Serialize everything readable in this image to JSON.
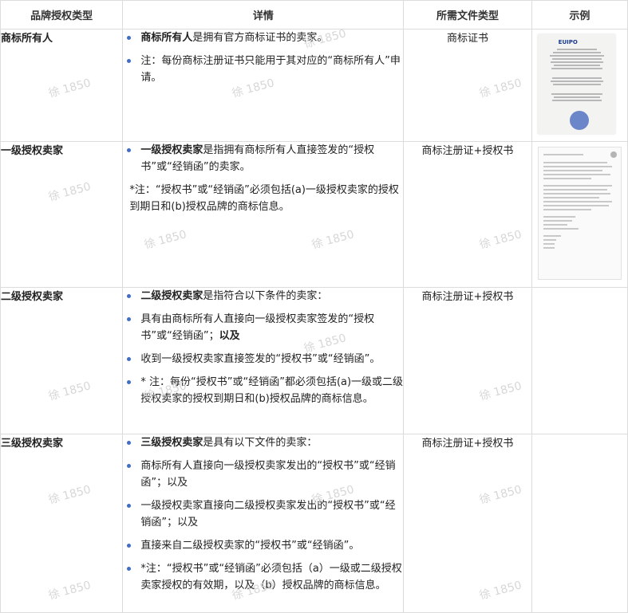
{
  "headers": [
    "品牌授权类型",
    "详情",
    "所需文件类型",
    "示例"
  ],
  "rows": [
    {
      "type": "商标所有人",
      "files": "商标证书",
      "bullets": [
        {
          "bold": "商标所有人",
          "text": "是拥有官方商标证书的卖家。"
        },
        {
          "bold": "",
          "text": "注：每份商标注册证书只能用于其对应的“商标所有人”申请。"
        }
      ],
      "note": "",
      "example": "certificate"
    },
    {
      "type": "一级授权卖家",
      "files": "商标注册证+授权书",
      "bullets": [
        {
          "bold": "一级授权卖家",
          "text": "是指拥有商标所有人直接签发的“授权书”或“经销函”的卖家。"
        }
      ],
      "note": "*注：“授权书”或“经销函”必须包括(a)一级授权卖家的授权到期日和(b)授权品牌的商标信息。",
      "example": "letter"
    },
    {
      "type": "二级授权卖家",
      "files": "商标注册证+授权书",
      "bullets": [
        {
          "bold": "二级授权卖家",
          "text": "是指符合以下条件的卖家："
        },
        {
          "bold": "",
          "text": "具有由商标所有人直接向一级授权卖家签发的“授权书”或“经销函”；",
          "tail_bold": "以及"
        },
        {
          "bold": "",
          "text": "收到一级授权卖家直接签发的“授权书”或“经销函”。"
        },
        {
          "bold": "",
          "text": "* 注：每份“授权书”或“经销函”都必须包括(a)一级或二级授权卖家的授权到期日和(b)授权品牌的商标信息。"
        }
      ],
      "note": "",
      "example": ""
    },
    {
      "type": "三级授权卖家",
      "files": "商标注册证+授权书",
      "bullets": [
        {
          "bold": "三级授权卖家",
          "text": "是具有以下文件的卖家："
        },
        {
          "bold": "",
          "text": "商标所有人直接向一级授权卖家发出的“授权书”或“经销函”；以及"
        },
        {
          "bold": "",
          "text": "一级授权卖家直接向二级授权卖家发出的“授权书”或“经销函”；以及"
        },
        {
          "bold": "",
          "text": "直接来自二级授权卖家的“授权书”或“经销函”。"
        },
        {
          "bold": "",
          "text": "*注：“授权书”或“经销函”必须包括（a）一级或二级授权卖家授权的有效期，以及（b）授权品牌的商标信息。"
        }
      ],
      "note": "",
      "example": ""
    }
  ],
  "examples": {
    "certificate_logo": "EUIPO"
  },
  "watermark": "徐 1850"
}
